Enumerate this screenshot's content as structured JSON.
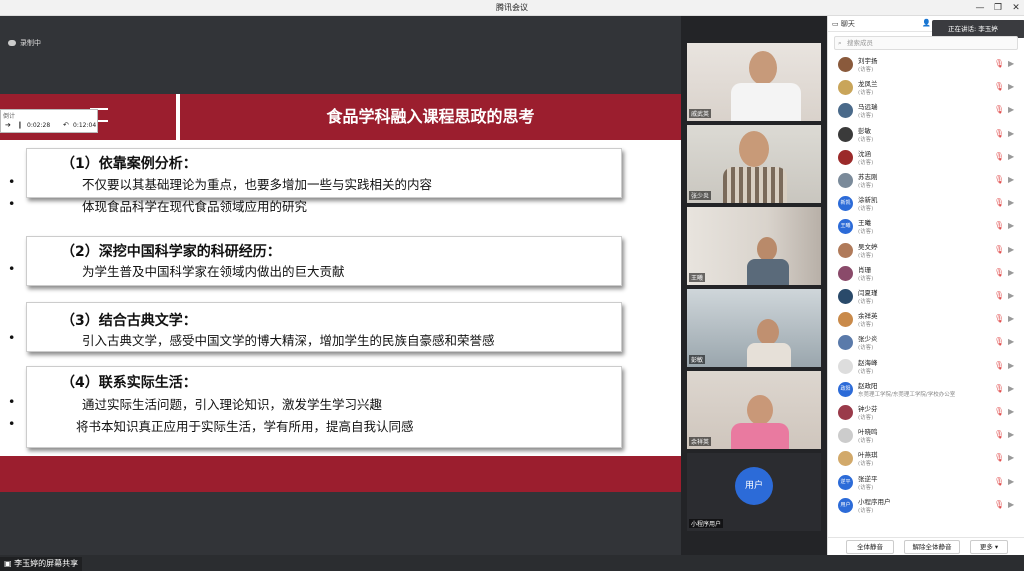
{
  "window": {
    "title": "腾讯会议",
    "minimize": "—",
    "restore": "❐",
    "close": "✕"
  },
  "recording": {
    "label": "录制中"
  },
  "timer": {
    "label": "倒计",
    "elapsed": "0:02:28",
    "remaining": "0:12:04",
    "play_icon": "➔",
    "pause_icon": "❙",
    "reset_icon": "↶"
  },
  "slide": {
    "title": "食品学科融入课程思政的思考",
    "sections": [
      {
        "heading": "（1）依靠案例分析：",
        "bullets": [
          "不仅要以其基础理论为重点，也要多增加一些与实践相关的内容",
          "体现食品科学在现代食品领域应用的研究"
        ]
      },
      {
        "heading": "（2）深挖中国科学家的科研经历：",
        "bullets": [
          "为学生普及中国科学家在领域内做出的巨大贡献"
        ]
      },
      {
        "heading": "（3）结合古典文学：",
        "bullets": [
          "引入古典文学，感受中国文学的博大精深，增加学生的民族自豪感和荣誉感"
        ]
      },
      {
        "heading": "（4）联系实际生活：",
        "bullets": [
          "通过实际生活问题，引入理论知识，激发学生学习兴趣",
          "将书本知识真正应用于实际生活，学有所用，提高自我认同感"
        ]
      }
    ],
    "bullet_char": "•"
  },
  "sharer": {
    "label": "李玉婷的屏幕共享"
  },
  "videos": [
    {
      "name": "戚武英"
    },
    {
      "name": "张少炎"
    },
    {
      "name": "王曦"
    },
    {
      "name": "彭敏"
    },
    {
      "name": "余祥英"
    },
    {
      "name": "小程序用户",
      "avatar_text": "用户"
    }
  ],
  "panel": {
    "tab_chat": "聊天",
    "speaking": "正在讲话: 李玉婷",
    "search_placeholder": "搜索成员",
    "members": [
      {
        "name": "刘宇扬",
        "role": "(访客)",
        "avatar": "",
        "color": "#8a5a3c"
      },
      {
        "name": "龙凤兰",
        "role": "(访客)",
        "avatar": "",
        "color": "#c9a55a"
      },
      {
        "name": "马远瑞",
        "role": "(访客)",
        "avatar": "",
        "color": "#4a6a8a"
      },
      {
        "name": "彭敏",
        "role": "(访客)",
        "avatar": "",
        "color": "#3a3a3a"
      },
      {
        "name": "沈涵",
        "role": "(访客)",
        "avatar": "",
        "color": "#9b2a2a"
      },
      {
        "name": "苏志刚",
        "role": "(访客)",
        "avatar": "",
        "color": "#7a8a9a"
      },
      {
        "name": "涂新凯",
        "role": "(访客)",
        "avatar": "新凯",
        "color": "#2c6bd8"
      },
      {
        "name": "王曦",
        "role": "(访客)",
        "avatar": "王曦",
        "color": "#2c6bd8"
      },
      {
        "name": "吴文婷",
        "role": "(访客)",
        "avatar": "",
        "color": "#b07a5a"
      },
      {
        "name": "肖珊",
        "role": "(访客)",
        "avatar": "",
        "color": "#8a4a6a"
      },
      {
        "name": "闫夏瑾",
        "role": "(访客)",
        "avatar": "",
        "color": "#2a4a6a"
      },
      {
        "name": "余祥英",
        "role": "(访客)",
        "avatar": "",
        "color": "#c98a4a"
      },
      {
        "name": "张少炎",
        "role": "(访客)",
        "avatar": "",
        "color": "#5a7aaa"
      },
      {
        "name": "赵海峰",
        "role": "(访客)",
        "avatar": "",
        "color": "#dddddd"
      },
      {
        "name": "赵政阳",
        "role": "东莞理工学院/东莞理工学院/学校办公室",
        "avatar": "政阳",
        "color": "#2c6bd8"
      },
      {
        "name": "钟少芬",
        "role": "(访客)",
        "avatar": "",
        "color": "#9a3a4a"
      },
      {
        "name": "叶晓鸣",
        "role": "(访客)",
        "avatar": "",
        "color": "#cccccc"
      },
      {
        "name": "叶燕琪",
        "role": "(访客)",
        "avatar": "",
        "color": "#d2a96a"
      },
      {
        "name": "张逆平",
        "role": "(访客)",
        "avatar": "逆平",
        "color": "#2c6bd8"
      },
      {
        "name": "小程序用户",
        "role": "(访客)",
        "avatar": "用户",
        "color": "#2c6bd8"
      }
    ],
    "btn_mute_all": "全体静音",
    "btn_unmute_all": "解除全体静音",
    "btn_more": "更多 ▾"
  },
  "icons": {
    "mic_off": "mic-off-icon",
    "camera_off": "camera-off-icon"
  }
}
